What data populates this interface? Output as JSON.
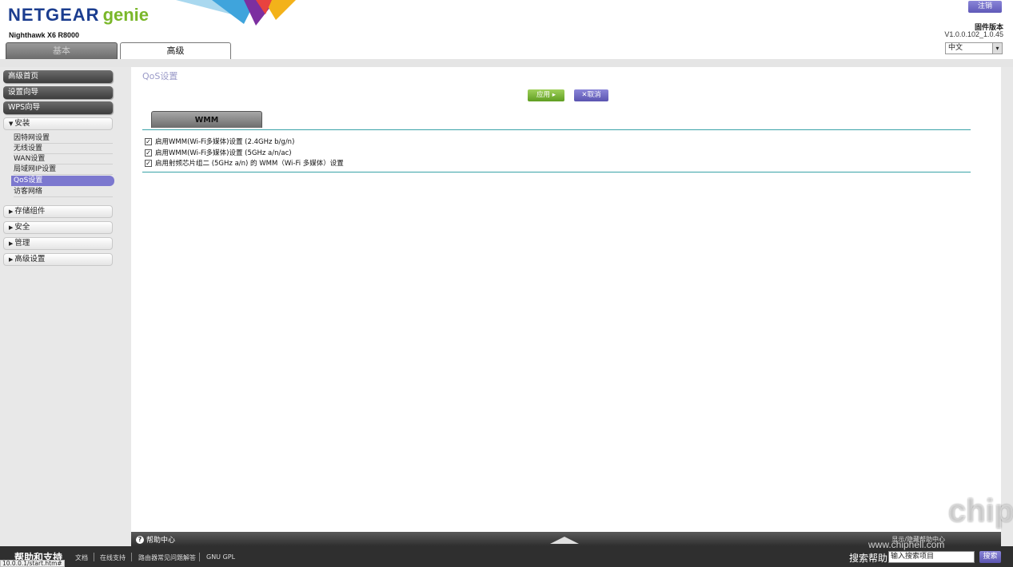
{
  "header": {
    "brand_netgear": "NETGEAR",
    "brand_genie": "genie",
    "model": "Nighthawk X6 R8000",
    "logout_label": "注销",
    "firmware_label": "固件版本",
    "firmware_version": "V1.0.0.102_1.0.45",
    "language": "中文",
    "tabs": {
      "basic": "基本",
      "advanced": "高级"
    }
  },
  "sidebar": {
    "dark_items": [
      "高级首页",
      "设置向导",
      "WPS向导"
    ],
    "setup_label": "安装",
    "setup_sub": [
      "因特网设置",
      "无线设置",
      "WAN设置",
      "局域网IP设置",
      "QoS设置",
      "访客网络"
    ],
    "collapsed": [
      "存储组件",
      "安全",
      "管理",
      "高级设置"
    ]
  },
  "main": {
    "page_title": "QoS设置",
    "apply_label": "应用 ▸",
    "cancel_label": "取消",
    "tab_label": "WMM",
    "options": [
      "启用WMM(Wi-Fi多媒体)设置 (2.4GHz b/g/n)",
      "启用WMM(Wi-Fi多媒体)设置 (5GHz a/n/ac)",
      "启用射频芯片组二 (5GHz a/n) 的 WMM（Wi-Fi 多媒体）设置"
    ]
  },
  "help": {
    "label": "帮助中心",
    "right_text": "显示/隐藏帮助中心"
  },
  "footer": {
    "title": "帮助和支持",
    "links": [
      "文档",
      "在线支持",
      "路由器常见问题解答",
      "GNU GPL"
    ],
    "search_label": "搜索帮助",
    "search_placeholder": "输入搜索项目",
    "search_button": "搜索"
  },
  "status_url": "10.0.0.1/start.htm#",
  "watermark": {
    "site": "www.chiphell.com",
    "mark": "chip hell"
  },
  "colors": {
    "accent": "#7c78cf",
    "brand_blue": "#1b3d8f",
    "brand_green": "#7ab72a",
    "teal": "#3aa3a8"
  }
}
